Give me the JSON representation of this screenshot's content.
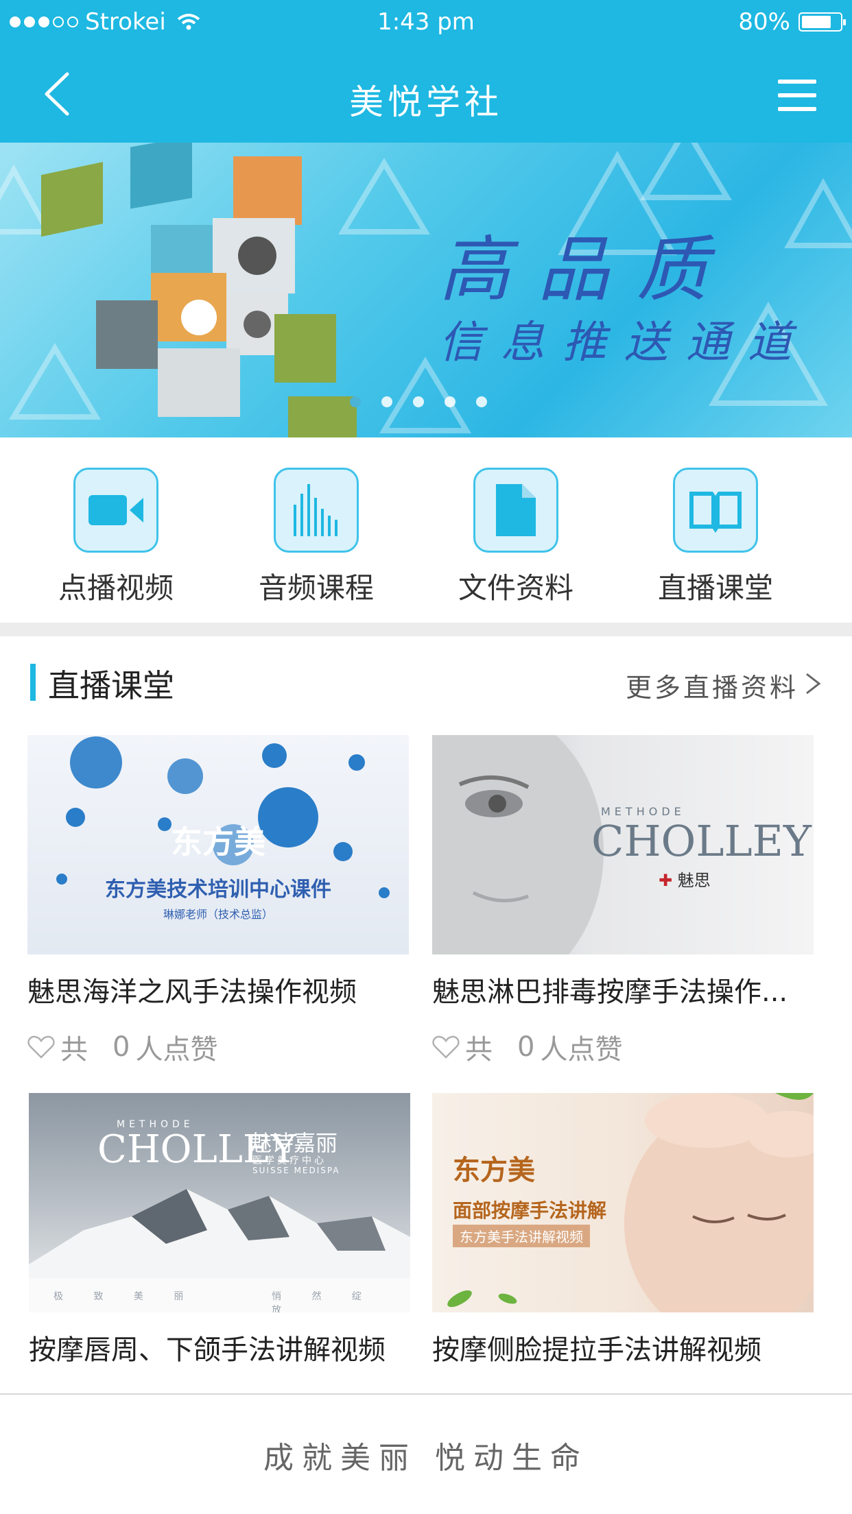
{
  "status_bar": {
    "carrier": "Strokei",
    "time": "1:43 pm",
    "battery": "80%",
    "battery_level": 0.8
  },
  "nav": {
    "title": "美悦学社",
    "back_icon": "chevron-left-icon",
    "menu_icon": "hamburger-menu-icon"
  },
  "banner": {
    "title": "高品质",
    "subtitle": "信息推送通道",
    "page_count": 5,
    "active_index": 0
  },
  "quick_links": [
    {
      "label": "点播视频",
      "icon": "video-camera-icon"
    },
    {
      "label": "音频课程",
      "icon": "audio-bars-icon"
    },
    {
      "label": "文件资料",
      "icon": "document-icon"
    },
    {
      "label": "直播课堂",
      "icon": "open-book-icon"
    }
  ],
  "section": {
    "title": "直播课堂",
    "more": "更多直播资料"
  },
  "cards": [
    {
      "title": "魅思海洋之风手法操作视频",
      "likes_prefix": "共",
      "likes_count": "0",
      "likes_suffix": "人点赞",
      "thumb_brand": "东方美",
      "thumb_line1": "东方美技术培训中心课件",
      "thumb_line2": "琳娜老师（技术总监）"
    },
    {
      "title": "魅思淋巴排毒按摩手法操作...",
      "likes_prefix": "共",
      "likes_count": "0",
      "likes_suffix": "人点赞",
      "thumb_brand_small": "METHODE",
      "thumb_brand": "CHOLLEY",
      "thumb_line1": "魅思"
    },
    {
      "title": "按摩唇周、下颌手法讲解视频",
      "thumb_brand_small": "METHODE",
      "thumb_brand": "CHOLLEY",
      "thumb_line1": "魅诗嘉丽",
      "thumb_line2": "医学美疗中心",
      "thumb_line3": "SUISSE MEDISPA",
      "thumb_tag_left": "极 致 美 丽",
      "thumb_tag_right": "悄 然 绽 放"
    },
    {
      "title": "按摩侧脸提拉手法讲解视频",
      "thumb_brand": "东方美",
      "thumb_line1": "面部按摩手法讲解",
      "thumb_line2": "东方美手法讲解视频"
    }
  ],
  "footer": {
    "slogan": "成就美丽   悦动生命"
  },
  "colors": {
    "primary": "#1eb8e2",
    "icon_bg": "#d9f2fb",
    "banner_text": "#2d58b3"
  }
}
